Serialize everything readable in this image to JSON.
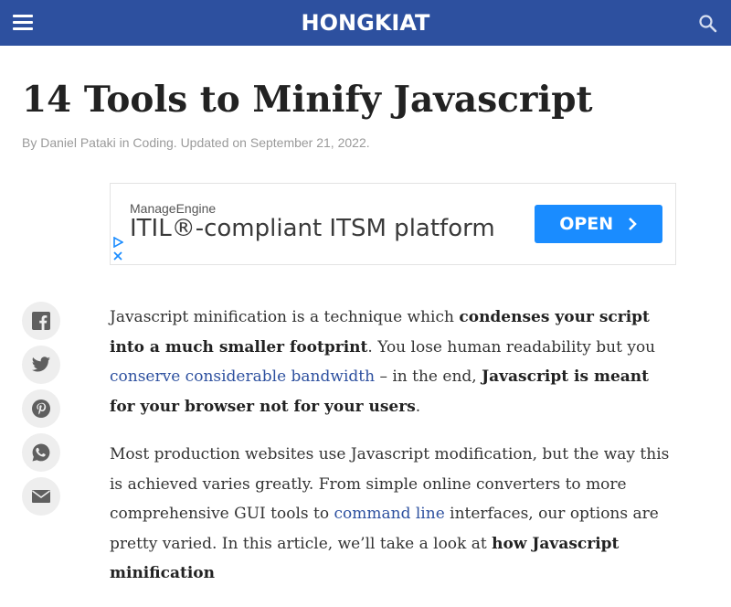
{
  "header": {
    "logo_text": "HONGKIAT",
    "background_color": "#2d509f",
    "menu_icon": "hamburger-menu-icon",
    "search_icon": "search-icon"
  },
  "article": {
    "title": "14 Tools to Minify Javascript",
    "byline": {
      "by": "By ",
      "author": "Daniel Pataki",
      "in": " in ",
      "category": "Coding",
      "updated": ". Updated on September 21, 2022."
    }
  },
  "ad": {
    "sponsor": "ManageEngine",
    "headline": "ITIL®-compliant ITSM platform",
    "cta": "OPEN",
    "cta_color": "#1a8cff"
  },
  "share": {
    "buttons": [
      "facebook-icon",
      "twitter-icon",
      "pinterest-icon",
      "whatsapp-icon",
      "email-icon"
    ]
  },
  "body": {
    "p1": {
      "t1": "Javascript minification is a technique which ",
      "b1": "condenses your script into a much smaller footprint",
      "t2": ". You lose human readability but you ",
      "link1": "conserve considerable bandwidth",
      "t3": " – in the end, ",
      "b2": "Javascript is meant for your browser not for your users",
      "t4": "."
    },
    "p2": {
      "t1": "Most production websites use Javascript modification, but the way this is achieved varies greatly. From simple online converters to more comprehensive GUI tools to ",
      "link1": "command line",
      "t2": " interfaces, our options are pretty varied. In this article, we’ll take a look at ",
      "b1": "how Javascript minification"
    }
  }
}
